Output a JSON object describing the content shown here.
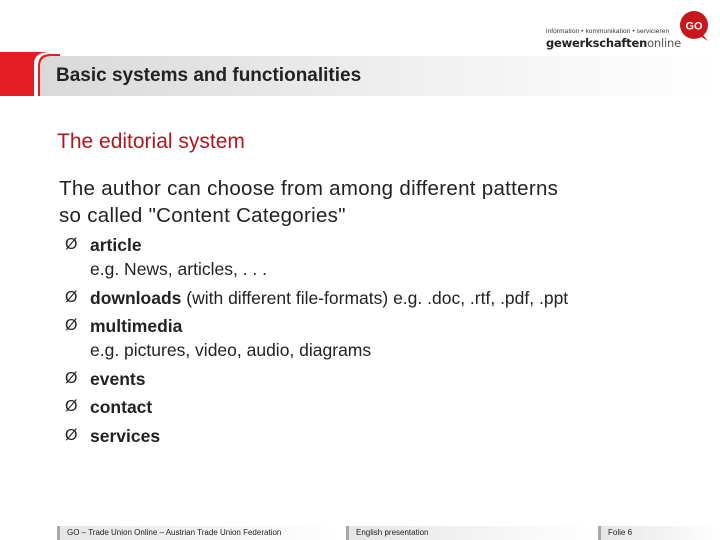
{
  "logo": {
    "tagline": "information • kommunikation • servicieren",
    "word_main": "gewerkschaften",
    "word_online": "online",
    "mark_text": "GO",
    "accent": "#c8161d"
  },
  "header": {
    "title": "Basic systems and functionalities",
    "bar_color": "#e51c24"
  },
  "content": {
    "subtitle": "The editorial system",
    "intro_lines": [
      "The author can choose from among different patterns",
      "so called \"Content Categories\""
    ],
    "bullet_symbol": "Ø",
    "bullets": [
      {
        "title": "article",
        "rest": "",
        "sub": "e.g. News, articles, . . ."
      },
      {
        "title": "downloads",
        "rest": " (with different file-formats) e.g. .doc, .rtf, .pdf, .ppt",
        "sub": ""
      },
      {
        "title": "multimedia",
        "rest": "",
        "sub": "e.g. pictures, video, audio, diagrams"
      },
      {
        "title": "events",
        "rest": "",
        "sub": ""
      },
      {
        "title": "contact",
        "rest": "",
        "sub": ""
      },
      {
        "title": "services",
        "rest": "",
        "sub": ""
      }
    ]
  },
  "footer": {
    "org": "GO – Trade Union Online – Austrian Trade Union Federation",
    "presentation": "English presentation",
    "page": "Folie 6"
  }
}
